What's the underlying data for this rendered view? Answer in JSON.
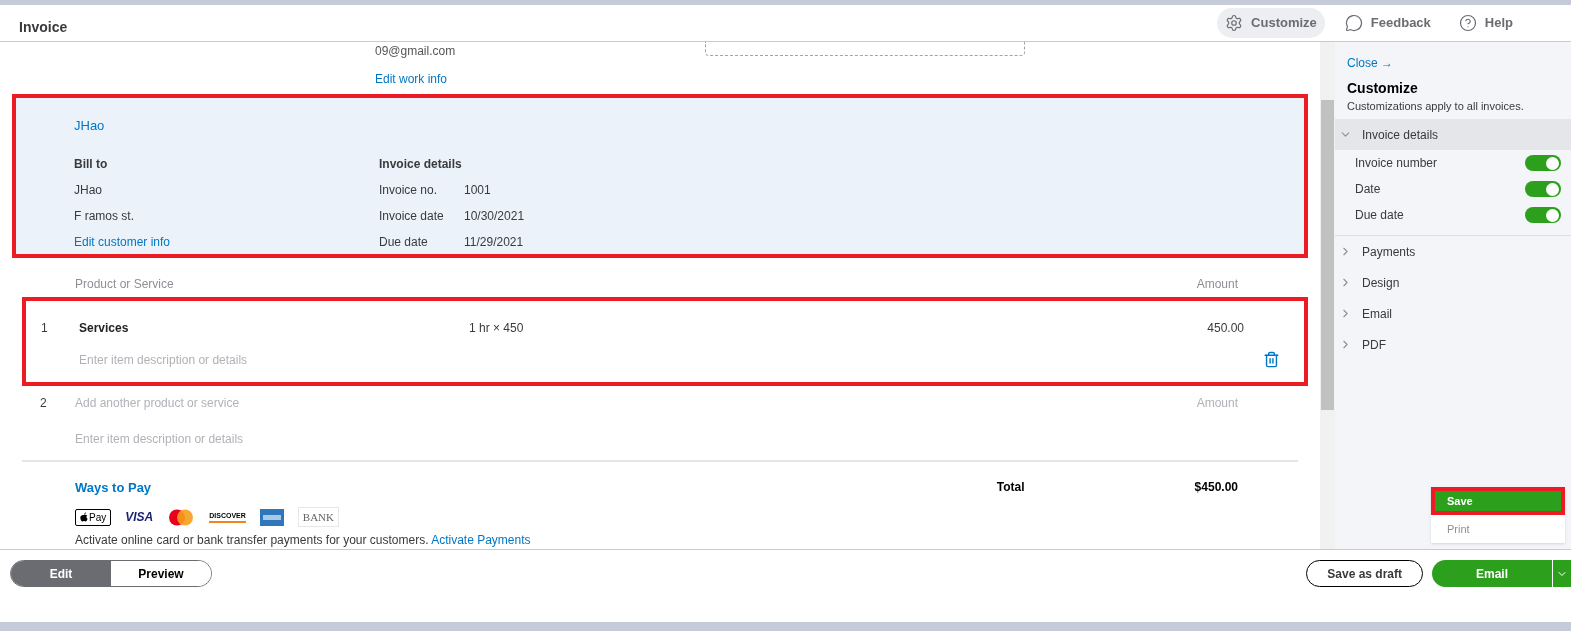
{
  "header": {
    "title": "Invoice",
    "actions": [
      {
        "label": "Customize",
        "kind": "gear",
        "selected": true
      },
      {
        "label": "Feedback",
        "kind": "chat",
        "selected": false
      },
      {
        "label": "Help",
        "kind": "help",
        "selected": false
      }
    ]
  },
  "company": {
    "email": "09@gmail.com",
    "edit_link": "Edit work info"
  },
  "customer": {
    "highlighted": true,
    "name": "JHao",
    "bill_to": {
      "heading": "Bill to",
      "lines": [
        "JHao",
        "F ramos st."
      ],
      "edit_link": "Edit customer info"
    },
    "details": {
      "heading": "Invoice details",
      "fields": [
        {
          "label": "Invoice no.",
          "value": "1001"
        },
        {
          "label": "Invoice date",
          "value": "10/30/2021"
        },
        {
          "label": "Due date",
          "value": "11/29/2021"
        }
      ]
    }
  },
  "line_items": {
    "columns": [
      "Product or Service",
      "Amount"
    ],
    "rows": [
      {
        "number": "1",
        "product": "Services",
        "quantity": "1 hr × 450",
        "amount": "450.00",
        "description": {
          "placeholder": "Enter item description or details"
        },
        "highlighted": true
      }
    ],
    "new_row": {
      "number": "2",
      "product": {
        "placeholder": "Add another product or service"
      },
      "amount": {
        "placeholder": "Amount"
      },
      "description": {
        "placeholder": "Enter item description or details"
      }
    }
  },
  "payment": {
    "title": "Ways to Pay",
    "methods": [
      {
        "kind": "apple",
        "label": "Pay"
      },
      {
        "kind": "visa",
        "label": "VISA"
      },
      {
        "kind": "mastercard"
      },
      {
        "kind": "discover",
        "label": "DISCOVER"
      },
      {
        "kind": "amex"
      },
      {
        "kind": "bank",
        "label": "BANK"
      }
    ],
    "note": "Activate online card or bank transfer payments for your customers.",
    "note_link": "Activate Payments"
  },
  "total": {
    "label": "Total",
    "value": "$450.00"
  },
  "panel": {
    "close": "Close →",
    "title": "Customize",
    "subtitle": "Customizations apply to all invoices.",
    "sections": [
      {
        "label": "Invoice details",
        "expanded": true,
        "options": [
          {
            "label": "Invoice number",
            "on": true
          },
          {
            "label": "Date",
            "on": true
          },
          {
            "label": "Due date",
            "on": true
          }
        ]
      },
      {
        "label": "Payments",
        "expanded": false
      },
      {
        "label": "Design",
        "expanded": false
      },
      {
        "label": "Email",
        "expanded": false
      },
      {
        "label": "PDF",
        "expanded": false
      }
    ]
  },
  "footer": {
    "tabs": [
      {
        "label": "Edit",
        "selected": true
      },
      {
        "label": "Preview",
        "selected": false
      }
    ],
    "draft": "Save as draft",
    "primary": "Email",
    "menu": [
      {
        "label": "Save",
        "selected": true,
        "highlighted": true
      },
      {
        "label": "Print",
        "selected": false,
        "highlighted": false
      }
    ]
  }
}
